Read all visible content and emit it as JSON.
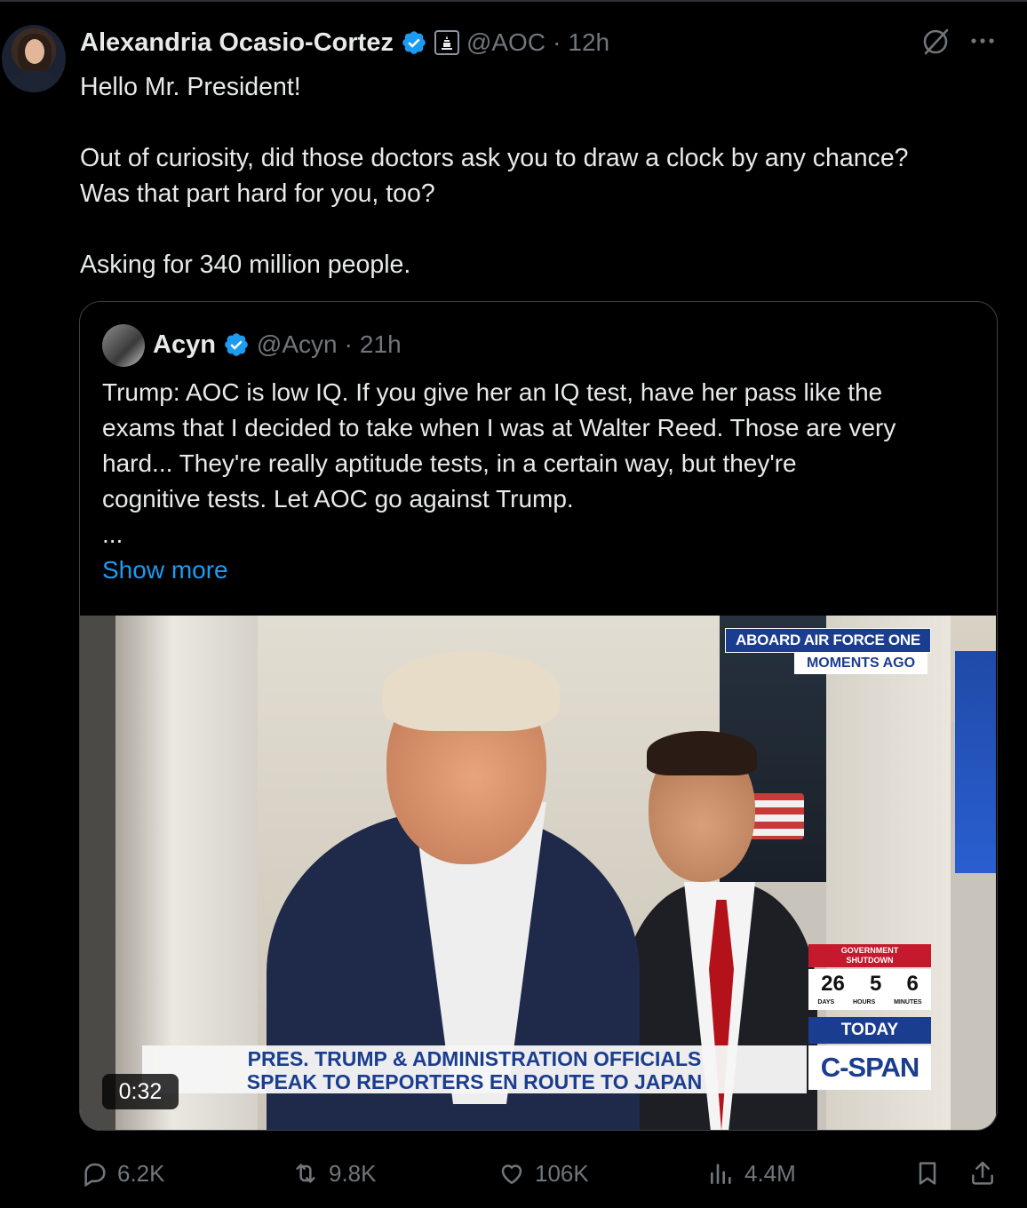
{
  "post": {
    "author_name": "Alexandria Ocasio-Cortez",
    "handle": "@AOC",
    "separator": "·",
    "time": "12h",
    "text_lines": [
      "Hello Mr. President!",
      "Out of curiosity, did those doctors ask you to draw a clock by any chance?",
      "Was that part hard for you, too?",
      "Asking for 340 million people."
    ]
  },
  "quote": {
    "author_name": "Acyn",
    "handle": "@Acyn",
    "separator": "·",
    "time": "21h",
    "text_lines": [
      "Trump: AOC is low IQ. If you give her an IQ test, have her pass like the",
      "exams that I decided to take when I was at Walter Reed. Those are very",
      "hard... They're really aptitude tests, in a certain way, but they're",
      "cognitive tests. Let AOC go against Trump."
    ],
    "ellipsis": "...",
    "show_more": "Show more"
  },
  "video": {
    "duration": "0:32",
    "chyron_top": "ABOARD AIR FORCE ONE",
    "chyron_sub": "MOMENTS AGO",
    "lower_third_line1": "PRES. TRUMP & ADMINISTRATION OFFICIALS",
    "lower_third_line2": "SPEAK TO REPORTERS EN ROUTE TO JAPAN",
    "shutdown_label_1": "GOVERNMENT",
    "shutdown_label_2": "SHUTDOWN",
    "shutdown_days": "26",
    "shutdown_hours": "5",
    "shutdown_minutes": "6",
    "shutdown_days_label": "DAYS",
    "shutdown_hours_label": "HOURS",
    "shutdown_minutes_label": "MINUTES",
    "today_label": "TODAY",
    "network": "C-SPAN"
  },
  "actions": {
    "replies": "6.2K",
    "reposts": "9.8K",
    "likes": "106K",
    "views": "4.4M"
  },
  "icons": {
    "verified": "verified-badge-icon",
    "gov": "capitol-badge-icon",
    "grok": "grok-icon",
    "more": "more-icon",
    "reply": "reply-icon",
    "repost": "repost-icon",
    "like": "like-icon",
    "views": "views-icon",
    "bookmark": "bookmark-icon",
    "share": "share-icon"
  },
  "colors": {
    "background": "#000000",
    "text": "#e7e9ea",
    "muted": "#71767b",
    "link": "#1d9bf0",
    "verified": "#1d9bf0",
    "border": "#3e4144"
  }
}
